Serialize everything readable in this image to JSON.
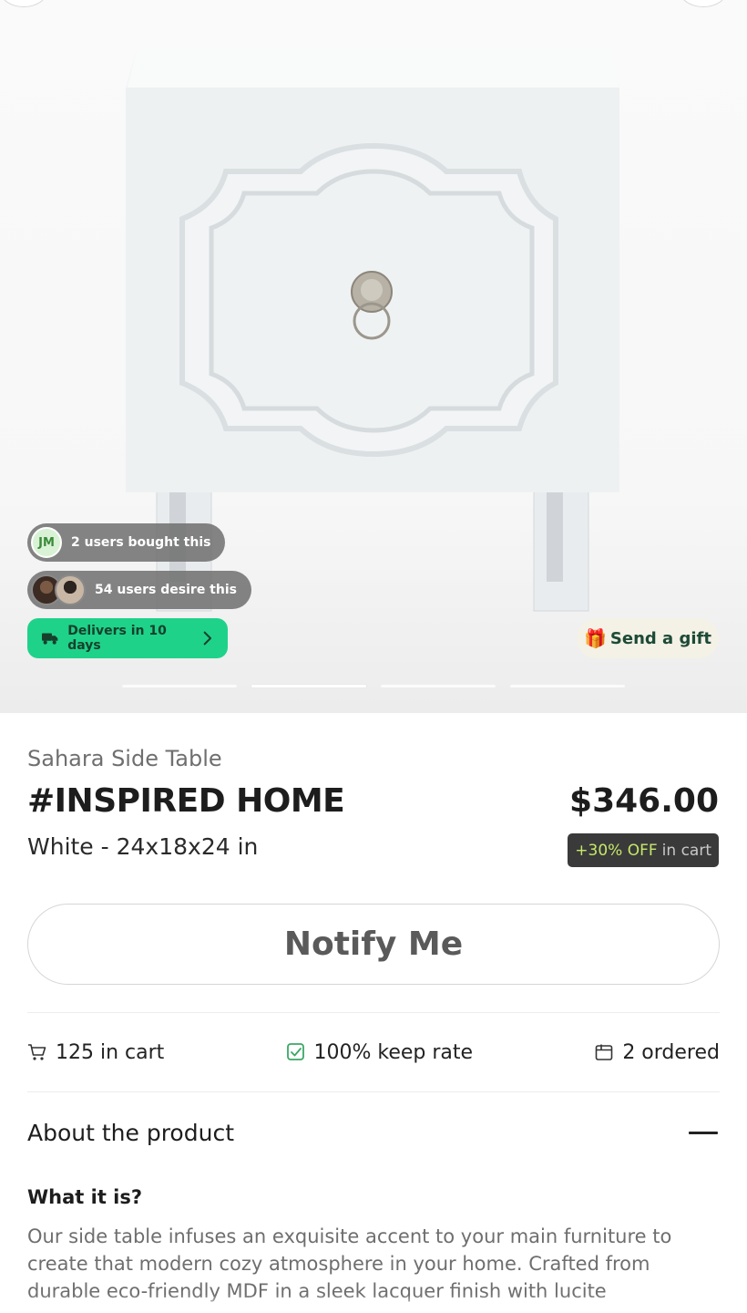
{
  "social": {
    "bought_initials": "JM",
    "bought_text": "2 users bought this",
    "desire_text": "54 users desire this"
  },
  "delivery": {
    "label": "Delivers in 10 days"
  },
  "gift": {
    "emoji": "🎁",
    "label": "Send a gift"
  },
  "carousel": {
    "pages": 4,
    "active_index": 1
  },
  "product": {
    "name": "Sahara Side Table",
    "brand": "#INSPIRED HOME",
    "variant": "White - 24x18x24 in",
    "price": "$346.00",
    "discount_pct": "+30% OFF",
    "discount_suffix": "in cart"
  },
  "actions": {
    "notify_label": "Notify Me"
  },
  "stats": {
    "in_cart": "125 in cart",
    "keep_rate": "100% keep rate",
    "ordered": "2 ordered"
  },
  "about": {
    "title": "About the product",
    "what_title": "What it is?",
    "description": "Our side table infuses an exquisite accent to your main furniture to create that modern cozy atmosphere in your home. Crafted from durable eco-friendly MDF in a sleek lacquer finish with lucite"
  },
  "colors": {
    "accent_green": "#1fd28a",
    "discount_highlight": "#c6e86a",
    "gift_bg": "#f4f1e6"
  }
}
